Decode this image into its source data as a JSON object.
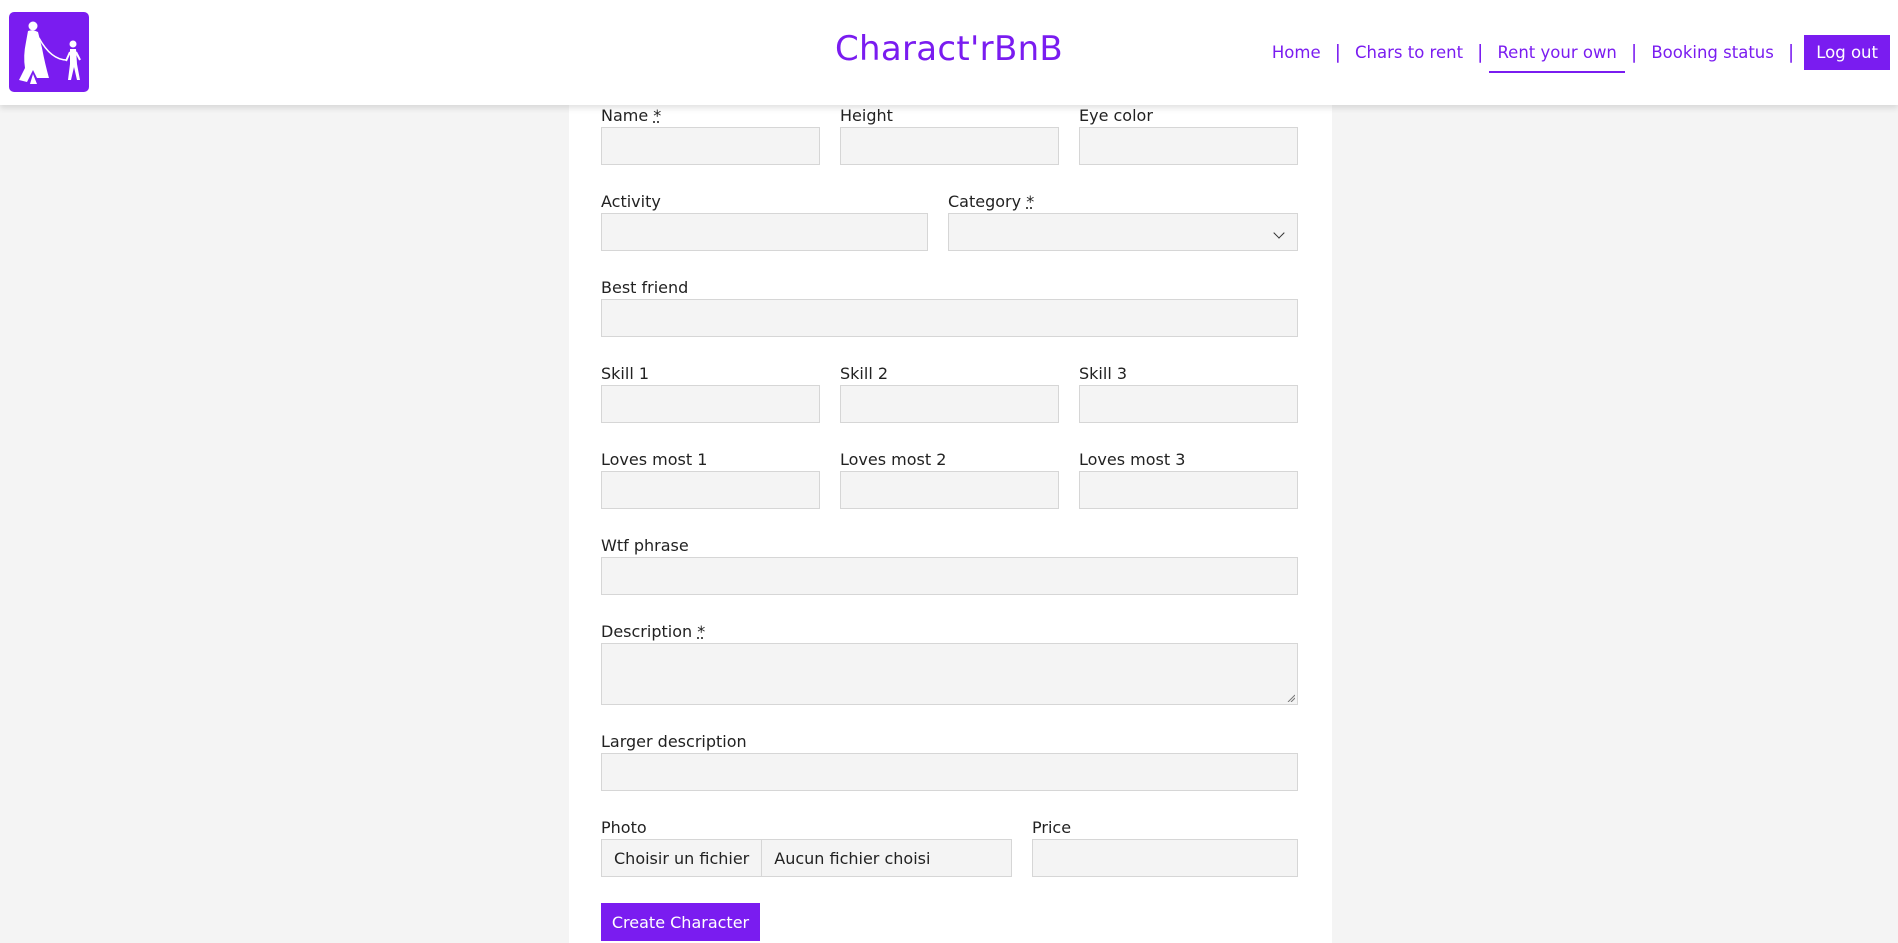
{
  "header": {
    "brand": "Charact'rBnB",
    "logo_icon": "person-walking-with-child-icon",
    "accent_color": "#7a1cf0"
  },
  "nav": {
    "items": [
      {
        "label": "Home"
      },
      {
        "label": "Chars to rent"
      },
      {
        "label": "Rent your own",
        "active": true
      },
      {
        "label": "Booking status"
      }
    ],
    "separator": "|",
    "logout_label": "Log out"
  },
  "form": {
    "required_marker": "*",
    "name": {
      "label": "Name",
      "value": ""
    },
    "height": {
      "label": "Height",
      "value": ""
    },
    "eye_color": {
      "label": "Eye color",
      "value": ""
    },
    "activity": {
      "label": "Activity",
      "value": ""
    },
    "category": {
      "label": "Category",
      "value": ""
    },
    "best_friend": {
      "label": "Best friend",
      "value": ""
    },
    "skill_1": {
      "label": "Skill 1",
      "value": ""
    },
    "skill_2": {
      "label": "Skill 2",
      "value": ""
    },
    "skill_3": {
      "label": "Skill 3",
      "value": ""
    },
    "loves_most_1": {
      "label": "Loves most 1",
      "value": ""
    },
    "loves_most_2": {
      "label": "Loves most 2",
      "value": ""
    },
    "loves_most_3": {
      "label": "Loves most 3",
      "value": ""
    },
    "wtf_phrase": {
      "label": "Wtf phrase",
      "value": ""
    },
    "description": {
      "label": "Description",
      "value": ""
    },
    "larger_description": {
      "label": "Larger description",
      "value": ""
    },
    "photo": {
      "label": "Photo",
      "button": "Choisir un fichier",
      "status": "Aucun fichier choisi"
    },
    "price": {
      "label": "Price",
      "value": ""
    },
    "submit_label": "Create Character"
  }
}
